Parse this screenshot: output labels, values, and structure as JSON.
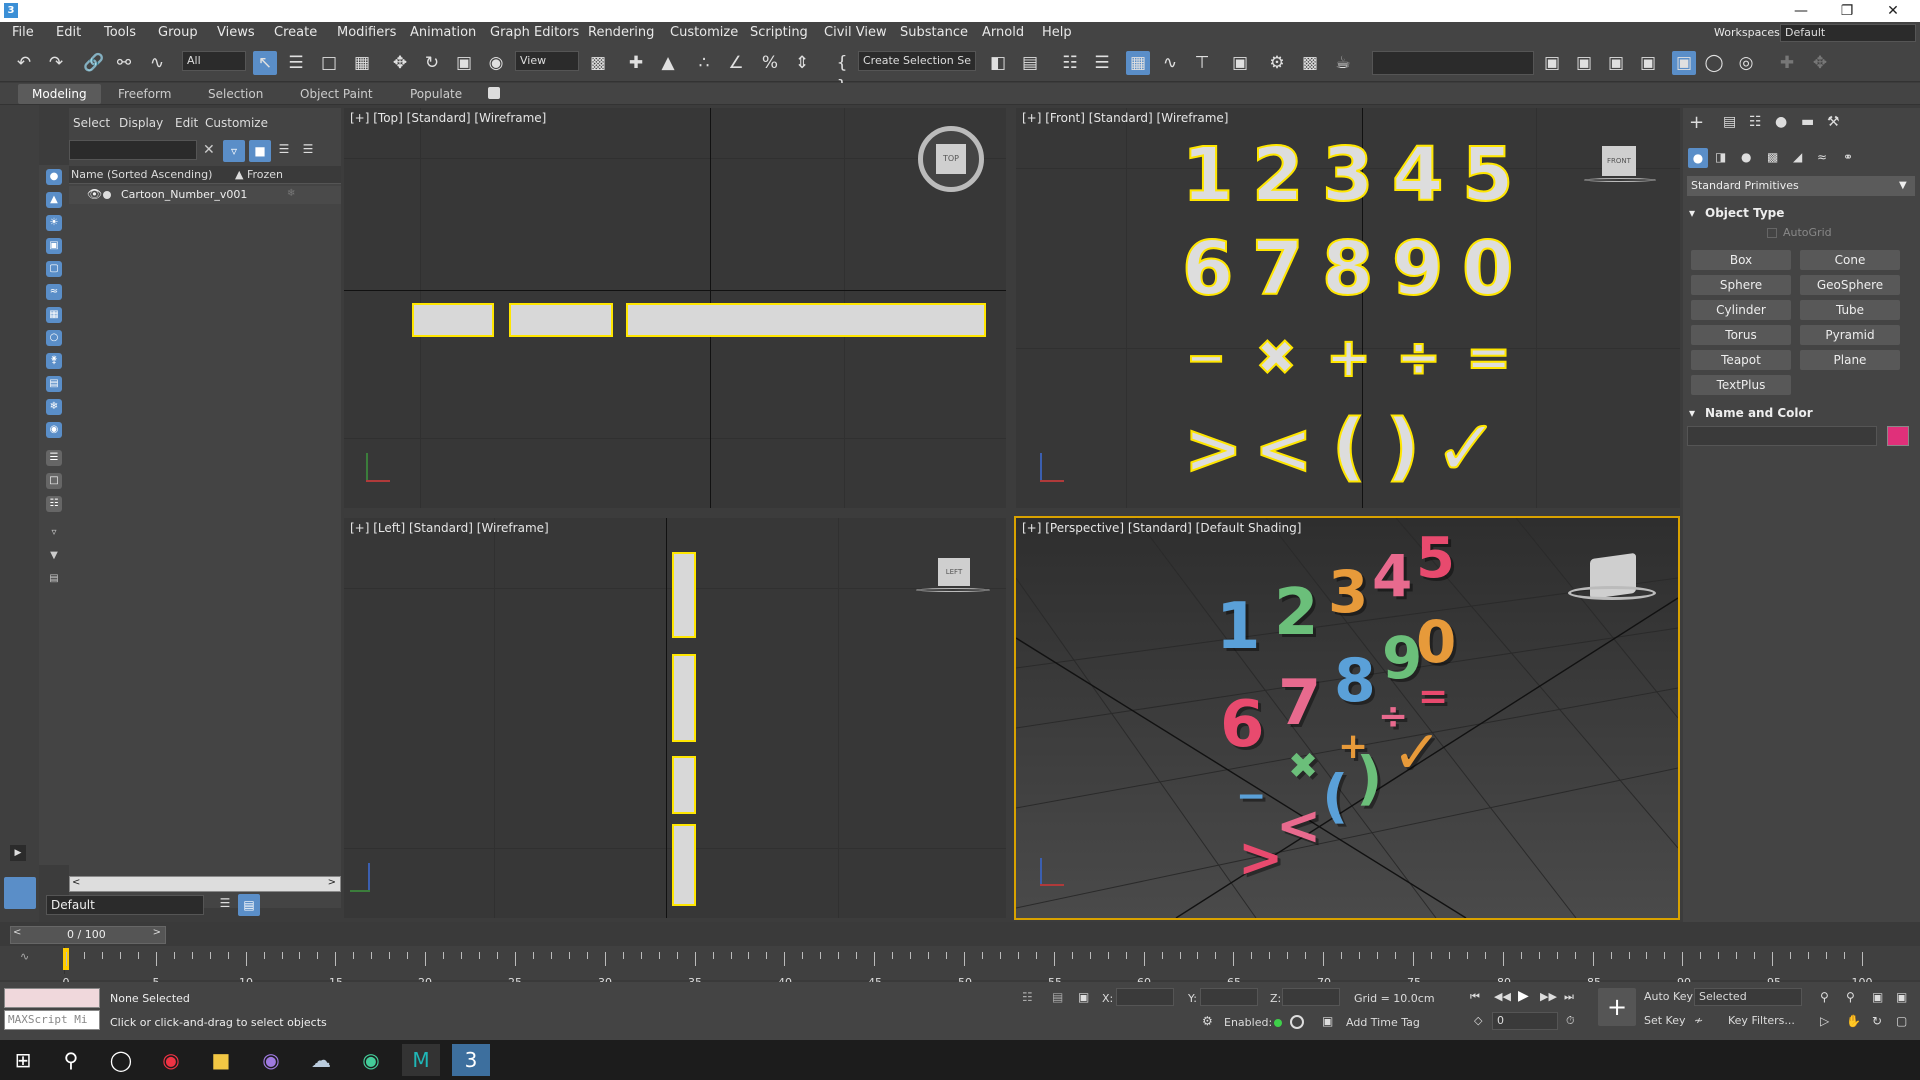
{
  "title_bar": {
    "app_icon": "3"
  },
  "menu": [
    "File",
    "Edit",
    "Tools",
    "Group",
    "Views",
    "Create",
    "Modifiers",
    "Animation",
    "Graph Editors",
    "Rendering",
    "Customize",
    "Scripting",
    "Civil View",
    "Substance",
    "Arnold",
    "Help"
  ],
  "workspace": {
    "label": "Workspaces:",
    "value": "Default"
  },
  "toolbar": {
    "filter_value": "All",
    "refcoord_value": "View",
    "selection_set": "Create Selection Se"
  },
  "ribbon_tabs": [
    "Modeling",
    "Freeform",
    "Selection",
    "Object Paint",
    "Populate"
  ],
  "scene_explorer": {
    "tabs": [
      "Select",
      "Display",
      "Edit",
      "Customize"
    ],
    "col_name": "Name (Sorted Ascending)",
    "col_frozen": "▲ Frozen",
    "rows": [
      "Cartoon_Number_v001"
    ],
    "layer": "Default"
  },
  "viewports": {
    "top": {
      "label": "[+] [Top] [Standard] [Wireframe]",
      "cube": "TOP"
    },
    "front": {
      "label": "[+] [Front] [Standard] [Wireframe]",
      "cube": "FRONT"
    },
    "left": {
      "label": "[+] [Left] [Standard] [Wireframe]",
      "cube": "LEFT"
    },
    "perspective": {
      "label": "[+] [Perspective] [Standard] [Default Shading]"
    }
  },
  "front_glyphs": {
    "row1": [
      "1",
      "2",
      "3",
      "4",
      "5"
    ],
    "row2": [
      "6",
      "7",
      "8",
      "9",
      "0"
    ],
    "row3": [
      "−",
      "✖",
      "+",
      "÷",
      "="
    ],
    "row4": [
      ">",
      "<",
      "(",
      ")",
      "✓"
    ]
  },
  "command_panel": {
    "dropdown": "Standard Primitives",
    "object_type": "Object Type",
    "autogrid": "AutoGrid",
    "buttons": [
      "Box",
      "Cone",
      "Sphere",
      "GeoSphere",
      "Cylinder",
      "Tube",
      "Torus",
      "Pyramid",
      "Teapot",
      "Plane",
      "TextPlus"
    ],
    "name_color": "Name and Color",
    "swatch_color": "#e0307a"
  },
  "timeline": {
    "frame": "0 / 100",
    "ticks": [
      "0",
      "5",
      "10",
      "15",
      "20",
      "25",
      "30",
      "35",
      "40",
      "45",
      "50",
      "55",
      "60",
      "65",
      "70",
      "75",
      "80",
      "85",
      "90",
      "95",
      "100"
    ]
  },
  "status": {
    "selection": "None Selected",
    "prompt": "Click or click-and-drag to select objects",
    "maxscript": "MAXScript Mi",
    "x_label": "X:",
    "y_label": "Y:",
    "z_label": "Z:",
    "grid": "Grid = 10.0cm",
    "enabled": "Enabled:",
    "add_time_tag": "Add Time Tag",
    "auto_key": "Auto Key",
    "selected": "Selected",
    "set_key": "Set Key",
    "key_filters": "Key Filters...",
    "frame_field": "0"
  }
}
